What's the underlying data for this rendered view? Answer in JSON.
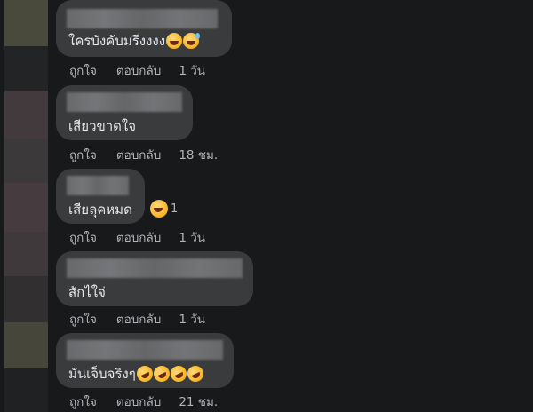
{
  "comments": [
    {
      "text": "ใครบังคับมรึงงงง",
      "emojis": [
        "grinning-squinting-face",
        "grinning-sweat-face"
      ],
      "actions": {
        "like": "ถูกใจ",
        "reply": "ตอบกลับ",
        "time": "1 วัน"
      }
    },
    {
      "text": "เสียวขาดใจ",
      "emojis": [],
      "actions": {
        "like": "ถูกใจ",
        "reply": "ตอบกลับ",
        "time": "18 ชม."
      }
    },
    {
      "text": "เสียลุคหมด",
      "emojis": [],
      "reaction": {
        "emoji": "haha-face",
        "count": "1"
      },
      "actions": {
        "like": "ถูกใจ",
        "reply": "ตอบกลับ",
        "time": "1 วัน"
      }
    },
    {
      "text": "สักไใจ่",
      "emojis": [],
      "actions": {
        "like": "ถูกใจ",
        "reply": "ตอบกลับ",
        "time": "1 วัน"
      }
    },
    {
      "text": "มันเจ็บจริงๆ",
      "emojis": [
        "rolling-laughing-face",
        "rolling-laughing-face",
        "rolling-laughing-face",
        "rolling-laughing-face"
      ],
      "actions": {
        "like": "ถูกใจ",
        "reply": "ตอบกลับ",
        "time": "21 ชม."
      }
    }
  ],
  "colors": {
    "background": "#18191a",
    "bubble": "#3a3b3c",
    "text": "#e4e6eb",
    "secondary_text": "#b0b3b8"
  }
}
